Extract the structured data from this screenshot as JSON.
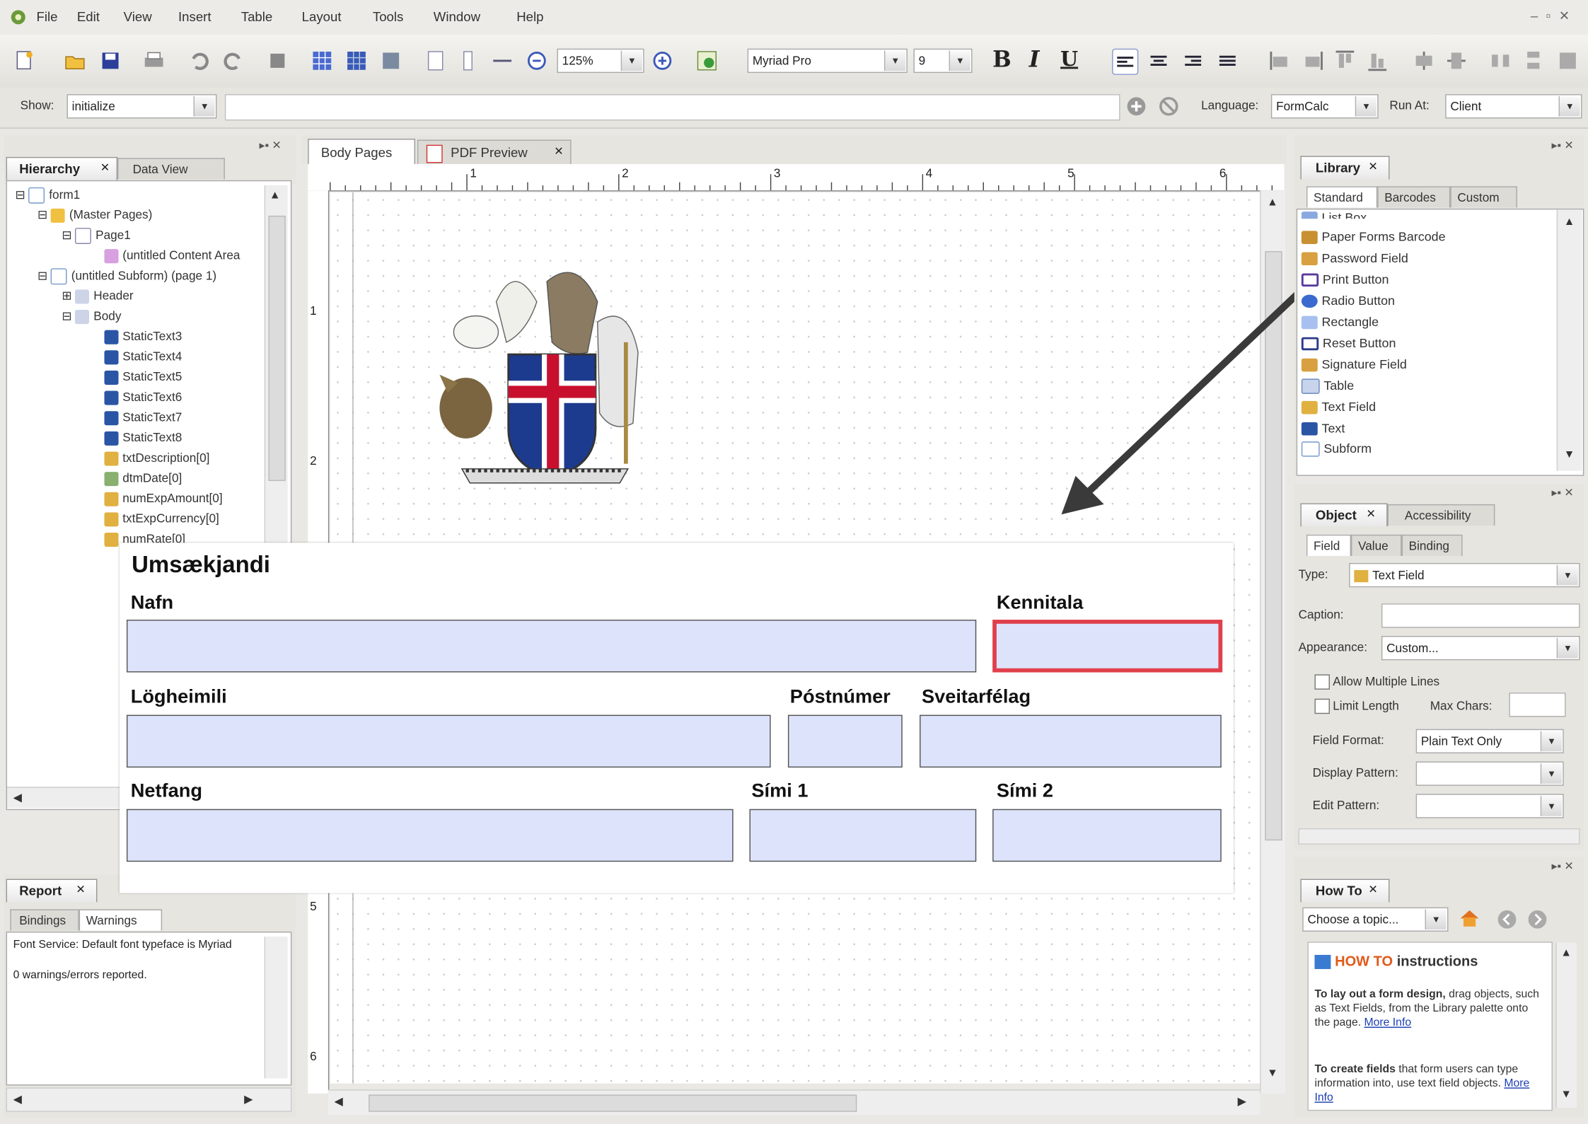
{
  "menu": [
    "File",
    "Edit",
    "View",
    "Insert",
    "Table",
    "Layout",
    "Tools",
    "Window",
    "Help"
  ],
  "toolbar": {
    "zoom": "125%",
    "font_name": "Myriad Pro",
    "font_size": "9",
    "bold": "B",
    "italic": "I",
    "underline": "U"
  },
  "scriptbar": {
    "show_label": "Show:",
    "show_value": "initialize",
    "language_label": "Language:",
    "language_value": "FormCalc",
    "runat_label": "Run At:",
    "runat_value": "Client"
  },
  "hierarchy": {
    "tabs": [
      "Hierarchy",
      "Data View"
    ],
    "items": [
      "form1",
      "(Master Pages)",
      "Page1",
      "(untitled Content Area",
      "(untitled Subform) (page 1)",
      "Header",
      "Body",
      "StaticText3",
      "StaticText4",
      "StaticText5",
      "StaticText6",
      "StaticText7",
      "StaticText8",
      "txtDescription[0]",
      "dtmDate[0]",
      "numExpAmount[0]",
      "txtExpCurrency[0]",
      "numRate[0]"
    ]
  },
  "report": {
    "title": "Report",
    "tabs": [
      "Bindings",
      "Warnings"
    ],
    "line1": "Font Service: Default font typeface is Myriad",
    "line2": "0 warnings/errors reported."
  },
  "center": {
    "tabs": [
      "Body Pages",
      "PDF Preview"
    ],
    "ruler_h": [
      "1",
      "2",
      "3",
      "4",
      "5",
      "6"
    ],
    "ruler_v": [
      "1",
      "2",
      "5",
      "6"
    ]
  },
  "form": {
    "heading": "Umsækjandi",
    "labels": {
      "nafn": "Nafn",
      "kennitala": "Kennitala",
      "logheimili": "Lögheimili",
      "postnumer": "Póstnúmer",
      "sveitarfelag": "Sveitarfélag",
      "netfang": "Netfang",
      "simi1": "Sími 1",
      "simi2": "Sími 2"
    }
  },
  "library": {
    "title": "Library",
    "tabs": [
      "Standard",
      "Barcodes",
      "Custom"
    ],
    "items": [
      "List Box",
      "Paper Forms Barcode",
      "Password Field",
      "Print Button",
      "Radio Button",
      "Rectangle",
      "Reset Button",
      "Signature Field",
      "Table",
      "Text Field",
      "Text",
      "Subform"
    ]
  },
  "object": {
    "tabs": [
      "Object",
      "Accessibility"
    ],
    "subtabs": [
      "Field",
      "Value",
      "Binding"
    ],
    "type_label": "Type:",
    "type_value": "Text Field",
    "caption_label": "Caption:",
    "appearance_label": "Appearance:",
    "appearance_value": "Custom...",
    "allow_multiple": "Allow Multiple Lines",
    "limit_length": "Limit Length",
    "max_chars": "Max Chars:",
    "field_format_label": "Field Format:",
    "field_format_value": "Plain Text Only",
    "display_pattern_label": "Display Pattern:",
    "edit_pattern_label": "Edit Pattern:"
  },
  "howto": {
    "title": "How To",
    "choose": "Choose a topic...",
    "heading_a": "HOW TO",
    "heading_b": " instructions",
    "p1_bold": "To lay out a form design,",
    "p1": " drag objects, such as Text Fields, from the Library palette onto the page.",
    "p2_bold": "To create fields",
    "p2": " that form users can type information into, use text field objects.",
    "more_info": "More Info"
  },
  "colors": {
    "field_fill": "#dde3fb",
    "highlight_border": "#e0404b",
    "arrow": "#3a3a3a"
  }
}
